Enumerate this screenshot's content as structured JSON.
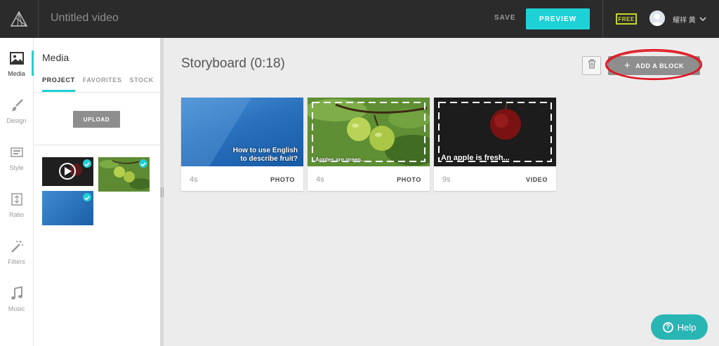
{
  "header": {
    "title": "Untitled video",
    "save_label": "SAVE",
    "preview_label": "PREVIEW",
    "plan_badge": "FREE",
    "user_name": "耀祥 黃"
  },
  "rail": {
    "items": [
      {
        "label": "Media",
        "icon": "image-icon",
        "active": true
      },
      {
        "label": "Design",
        "icon": "brush-icon"
      },
      {
        "label": "Style",
        "icon": "style-icon"
      },
      {
        "label": "Ratio",
        "icon": "ratio-icon"
      },
      {
        "label": "Filters",
        "icon": "magic-wand-icon"
      },
      {
        "label": "Music",
        "icon": "music-note-icon"
      }
    ]
  },
  "panel": {
    "title": "Media",
    "tabs": [
      {
        "label": "PROJECT",
        "active": true
      },
      {
        "label": "FAVORITES"
      },
      {
        "label": "STOCK"
      }
    ],
    "upload_label": "UPLOAD",
    "thumbnails": [
      {
        "type": "video",
        "selected": true
      },
      {
        "type": "photo",
        "selected": true
      },
      {
        "type": "photo",
        "selected": true
      }
    ]
  },
  "storyboard": {
    "title": "Storyboard (0:18)",
    "add_block_label": "ADD A BLOCK",
    "cards": [
      {
        "duration": "4s",
        "type": "PHOTO",
        "caption_line1": "How to use English",
        "caption_line2": "to describe fruit?"
      },
      {
        "duration": "4s",
        "type": "PHOTO",
        "caption": "Apples are green..."
      },
      {
        "duration": "9s",
        "type": "VIDEO",
        "caption": "An apple is fresh..."
      }
    ]
  },
  "help": {
    "label": "Help"
  },
  "colors": {
    "accent": "#1ed1d6",
    "topbar": "#2b2b2b",
    "badge": "#c6d629",
    "highlight": "#e0141e"
  }
}
